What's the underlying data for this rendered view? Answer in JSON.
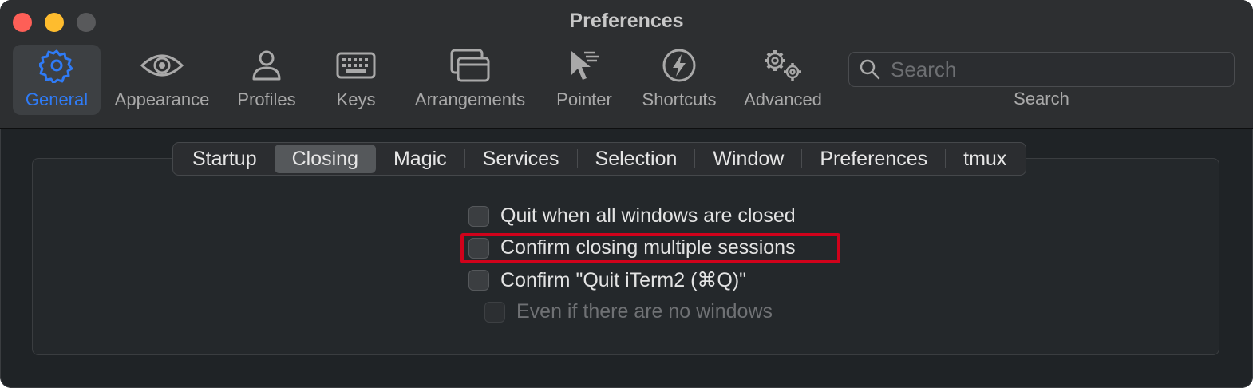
{
  "window": {
    "title": "Preferences"
  },
  "toolbar": {
    "items": [
      {
        "label": "General",
        "icon": "gear-icon"
      },
      {
        "label": "Appearance",
        "icon": "eye-icon"
      },
      {
        "label": "Profiles",
        "icon": "person-icon"
      },
      {
        "label": "Keys",
        "icon": "keyboard-icon"
      },
      {
        "label": "Arrangements",
        "icon": "windows-icon"
      },
      {
        "label": "Pointer",
        "icon": "pointer-icon"
      },
      {
        "label": "Shortcuts",
        "icon": "lightning-icon"
      },
      {
        "label": "Advanced",
        "icon": "gears-icon"
      }
    ],
    "selected": "General",
    "search": {
      "placeholder": "Search",
      "label": "Search"
    }
  },
  "tabs": {
    "items": [
      "Startup",
      "Closing",
      "Magic",
      "Services",
      "Selection",
      "Window",
      "Preferences",
      "tmux"
    ],
    "selected": "Closing"
  },
  "options": [
    {
      "label": "Quit when all windows are closed",
      "checked": false,
      "enabled": true
    },
    {
      "label": "Confirm closing multiple sessions",
      "checked": false,
      "enabled": true,
      "highlighted": true
    },
    {
      "label": "Confirm \"Quit iTerm2 (⌘Q)\"",
      "checked": false,
      "enabled": true
    },
    {
      "label": "Even if there are no windows",
      "checked": false,
      "enabled": false
    }
  ],
  "colors": {
    "accent": "#2f7bf6",
    "highlight": "#d0021b",
    "close": "#fe5f57",
    "minimize": "#febc2e"
  }
}
